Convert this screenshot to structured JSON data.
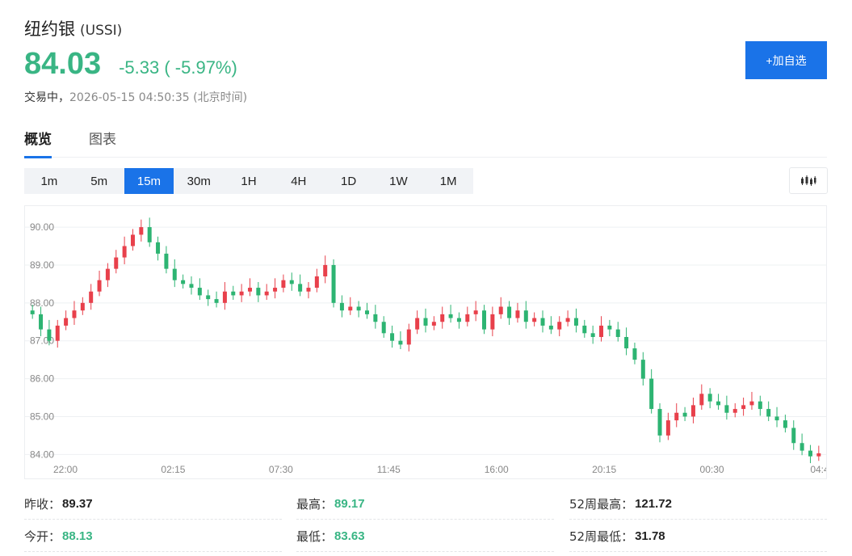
{
  "stock": {
    "name": "纽约银",
    "code": "(USSI)",
    "price": "84.03",
    "change": "-5.33 ( -5.97%)",
    "status": "交易中，",
    "timestamp": "2026-05-15 04:50:35 (北京时间)"
  },
  "add_button_label": "+加自选",
  "tabs": [
    {
      "label": "概览",
      "active": true
    },
    {
      "label": "图表",
      "active": false
    }
  ],
  "periods": [
    {
      "label": "1m",
      "active": false
    },
    {
      "label": "5m",
      "active": false
    },
    {
      "label": "15m",
      "active": true
    },
    {
      "label": "30m",
      "active": false
    },
    {
      "label": "1H",
      "active": false
    },
    {
      "label": "4H",
      "active": false
    },
    {
      "label": "1D",
      "active": false
    },
    {
      "label": "1W",
      "active": false
    },
    {
      "label": "1M",
      "active": false
    }
  ],
  "chart_type_icon": "candlestick-icon",
  "colors": {
    "up": "#e8404b",
    "down": "#2db472",
    "accent": "#1a73e8",
    "price_green": "#39b584"
  },
  "chart_data": {
    "type": "candlestick",
    "y_ticks": [
      "90.00",
      "89.00",
      "88.00",
      "87.00",
      "86.00",
      "85.00",
      "84.00"
    ],
    "ylim": [
      83.9,
      90.3
    ],
    "x_ticks": [
      "22:00",
      "02:15",
      "07:30",
      "11:45",
      "16:00",
      "20:15",
      "00:30",
      "04:4"
    ],
    "grid": true,
    "series": [
      {
        "name": "",
        "close_path": [
          87.7,
          87.3,
          87.0,
          87.4,
          87.6,
          87.8,
          88.0,
          88.3,
          88.6,
          88.9,
          89.2,
          89.5,
          89.8,
          90.0,
          89.6,
          89.3,
          88.9,
          88.6,
          88.5,
          88.4,
          88.2,
          88.1,
          88.0,
          88.3,
          88.2,
          88.3,
          88.4,
          88.2,
          88.3,
          88.4,
          88.6,
          88.5,
          88.3,
          88.4,
          88.7,
          89.0,
          88.0,
          87.8,
          87.9,
          87.8,
          87.7,
          87.5,
          87.2,
          87.0,
          86.9,
          87.3,
          87.6,
          87.4,
          87.5,
          87.7,
          87.6,
          87.5,
          87.7,
          87.8,
          87.3,
          87.7,
          87.9,
          87.6,
          87.8,
          87.5,
          87.6,
          87.4,
          87.3,
          87.5,
          87.6,
          87.4,
          87.2,
          87.1,
          87.4,
          87.3,
          87.1,
          86.8,
          86.5,
          86.0,
          85.2,
          84.5,
          84.9,
          85.1,
          85.0,
          85.3,
          85.6,
          85.4,
          85.3,
          85.1,
          85.2,
          85.3,
          85.4,
          85.2,
          85.0,
          84.9,
          84.7,
          84.3,
          84.1,
          83.95,
          84.03
        ]
      }
    ]
  },
  "stats": [
    {
      "label": "昨收：",
      "value": "89.37",
      "tone": "dark"
    },
    {
      "label": "最高：",
      "value": "89.17",
      "tone": "green"
    },
    {
      "label": "52周最高：",
      "value": "121.72",
      "tone": "dark"
    },
    {
      "label": "今开：",
      "value": "88.13",
      "tone": "green"
    },
    {
      "label": "最低：",
      "value": "83.63",
      "tone": "green"
    },
    {
      "label": "52周最低：",
      "value": "31.78",
      "tone": "dark"
    }
  ]
}
